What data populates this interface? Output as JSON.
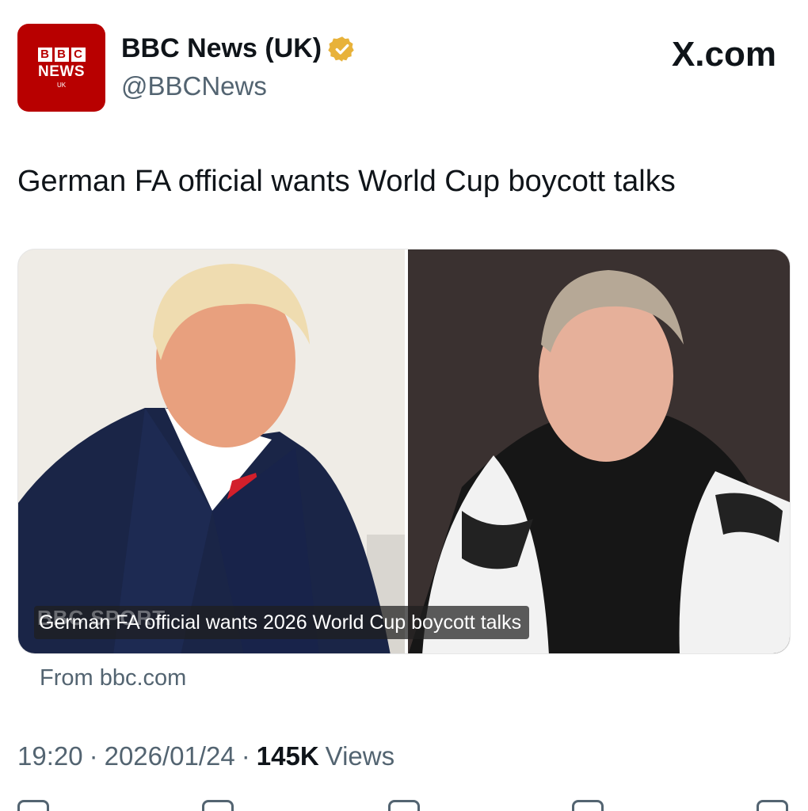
{
  "account": {
    "avatar": {
      "bbc_letters": [
        "B",
        "B",
        "C"
      ],
      "news": "NEWS",
      "region": "UK"
    },
    "display_name": "BBC News (UK)",
    "verified_icon": "gold-verified-badge-icon",
    "handle": "@BBCNews"
  },
  "site_label": "X.com",
  "tweet": {
    "text": "German FA official wants World Cup boycott talks"
  },
  "card": {
    "brand_watermark": "BBC SPORT",
    "caption": "German FA official wants 2026 World Cup boycott talks",
    "source": "From bbc.com"
  },
  "meta": {
    "time": "19:20",
    "separator": "·",
    "date": "2026/01/24",
    "views_count": "145K",
    "views_label": "Views"
  },
  "action_icons": [
    "reply-icon",
    "retweet-icon",
    "like-icon",
    "bookmark-icon",
    "share-icon"
  ],
  "colors": {
    "brand_red": "#b80000",
    "text": "#0f1419",
    "muted": "#536471",
    "verified": "#e8b23a"
  }
}
